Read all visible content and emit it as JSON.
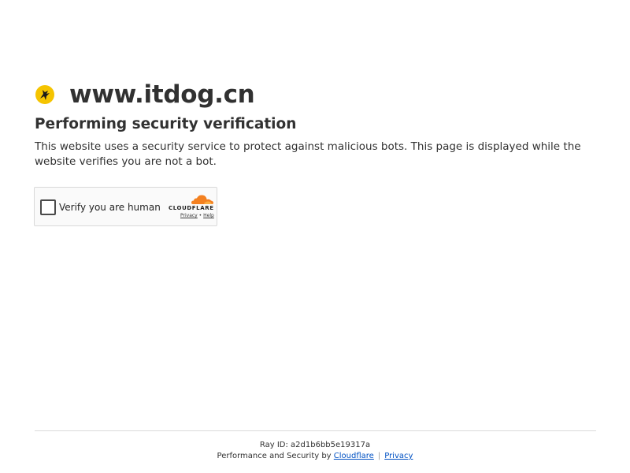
{
  "site": {
    "name": "www.itdog.cn",
    "logo_icon": "itdog-logo-icon",
    "logo_color": "#f5c400"
  },
  "heading": "Performing security verification",
  "description": "This website uses a security service to protect against malicious bots. This page is displayed while the website verifies you are not a bot.",
  "widget": {
    "checkbox_label": "Verify you are human",
    "checked": false,
    "brand": "CLOUDFLARE",
    "brand_color": "#f38020",
    "privacy_link": "Privacy",
    "link_separator": "•",
    "help_link": "Help"
  },
  "footer": {
    "ray_id": "Ray ID: a2d1b6bb5e19317a",
    "performance_prefix": "Performance and Security by",
    "cloudflare_link": "Cloudflare",
    "separator": "|",
    "privacy_link": "Privacy",
    "link_color": "#0051c3"
  }
}
